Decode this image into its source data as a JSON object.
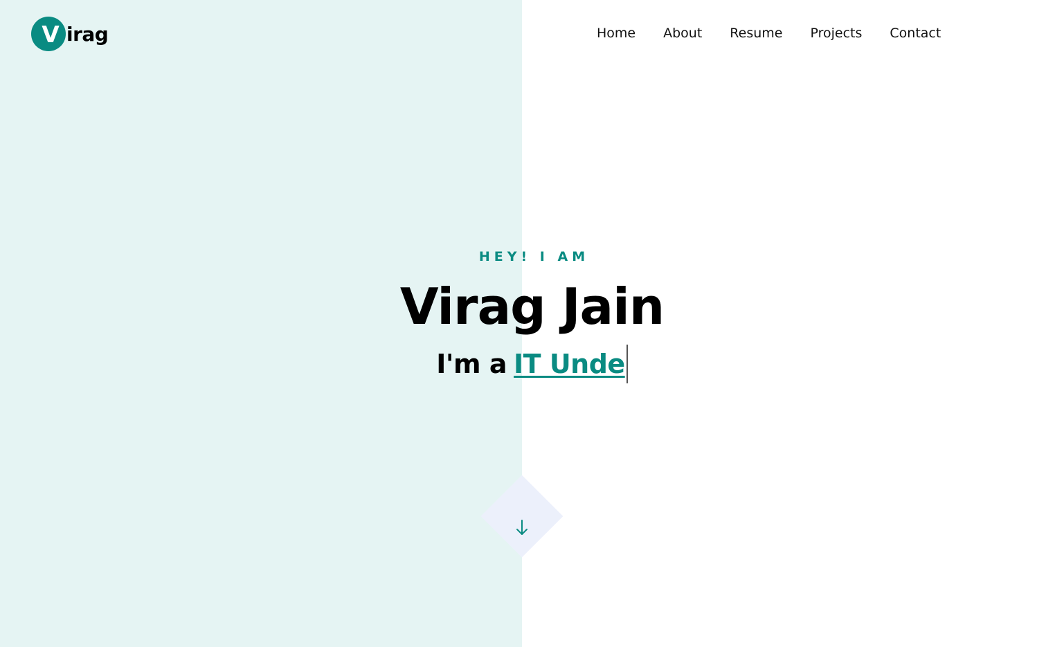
{
  "brand": {
    "logo_initial": "V",
    "logo_rest": "irag",
    "accent_color": "#0a8b82"
  },
  "nav": {
    "items": [
      {
        "label": "Home"
      },
      {
        "label": "About"
      },
      {
        "label": "Resume"
      },
      {
        "label": "Projects"
      },
      {
        "label": "Contact"
      }
    ]
  },
  "hero": {
    "eyebrow": "HEY! I AM",
    "name": "Virag Jain",
    "typed_prefix": "I'm a",
    "typed_text": "IT Unde"
  },
  "scroll": {
    "icon": "arrow-down-icon"
  },
  "colors": {
    "left_panel_bg": "#e5f4f3",
    "page_bg": "#ffffff",
    "diamond_bg": "#ecf0fb"
  }
}
